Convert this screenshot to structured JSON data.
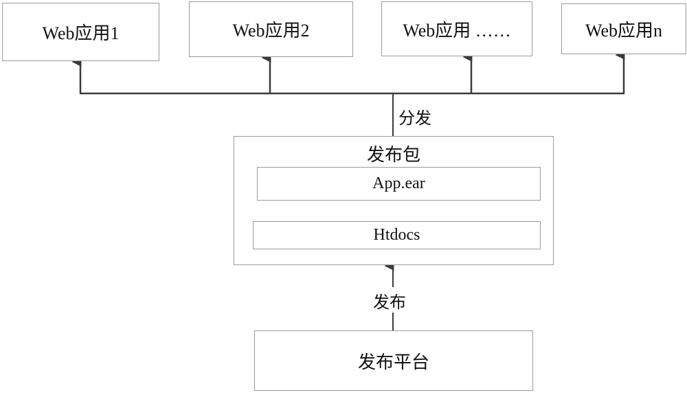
{
  "web_apps": [
    {
      "label": "Web应用1"
    },
    {
      "label": "Web应用2"
    },
    {
      "label": "Web应用 ……"
    },
    {
      "label": "Web应用n"
    }
  ],
  "distribute_label": "分发",
  "package": {
    "title": "发布包",
    "items": [
      {
        "label": "App.ear"
      },
      {
        "label": "Htdocs"
      }
    ]
  },
  "publish_label": "发布",
  "platform": {
    "label": "发布平台"
  },
  "colors": {
    "line": "#3a3a3a",
    "border": "#9a9a9a"
  }
}
